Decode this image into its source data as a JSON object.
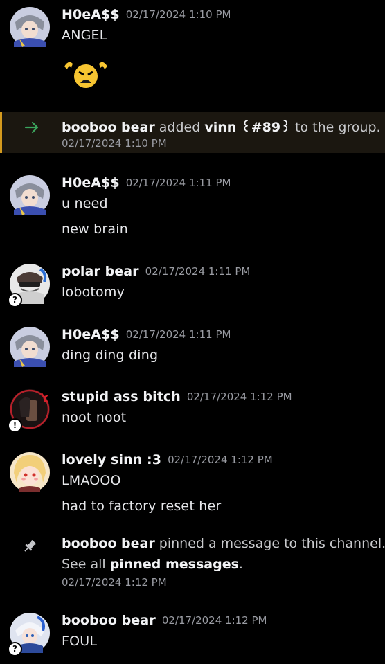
{
  "messages": [
    {
      "author": "H0eA$$",
      "time": "02/17/2024 1:10 PM",
      "lines": [
        "ANGEL"
      ]
    },
    {
      "author": "H0eA$$",
      "time": "02/17/2024 1:11 PM",
      "lines": [
        "u need",
        "new brain"
      ]
    },
    {
      "author": "polar bear",
      "time": "02/17/2024 1:11 PM",
      "lines": [
        "lobotomy"
      ]
    },
    {
      "author": "H0eA$$",
      "time": "02/17/2024 1:11 PM",
      "lines": [
        "ding ding ding"
      ]
    },
    {
      "author": "stupid ass bitch",
      "time": "02/17/2024 1:12 PM",
      "lines": [
        "noot noot"
      ]
    },
    {
      "author": "lovely sinn :3",
      "time": "02/17/2024 1:12 PM",
      "lines": [
        "LMAOOO",
        "had to factory reset her"
      ]
    },
    {
      "author": "booboo bear",
      "time": "02/17/2024 1:12 PM",
      "lines": [
        "FOUL"
      ]
    }
  ],
  "system_add": {
    "actor": "booboo bear",
    "verb": "added",
    "target": "vinn ꒰#89꒱",
    "rest": "to the group.",
    "time": "02/17/2024 1:10 PM"
  },
  "system_pin": {
    "actor": "booboo bear",
    "text": "pinned a message to this channel.",
    "see_prefix": "See all",
    "see_link": "pinned messages",
    "see_suffix": ".",
    "time": "02/17/2024 1:12 PM"
  },
  "badges": {
    "question": "?",
    "exclaim": "!"
  },
  "colors": {
    "accent_green": "#3ba55d",
    "highlight_bar": "#d49a1e",
    "background": "#000000"
  }
}
